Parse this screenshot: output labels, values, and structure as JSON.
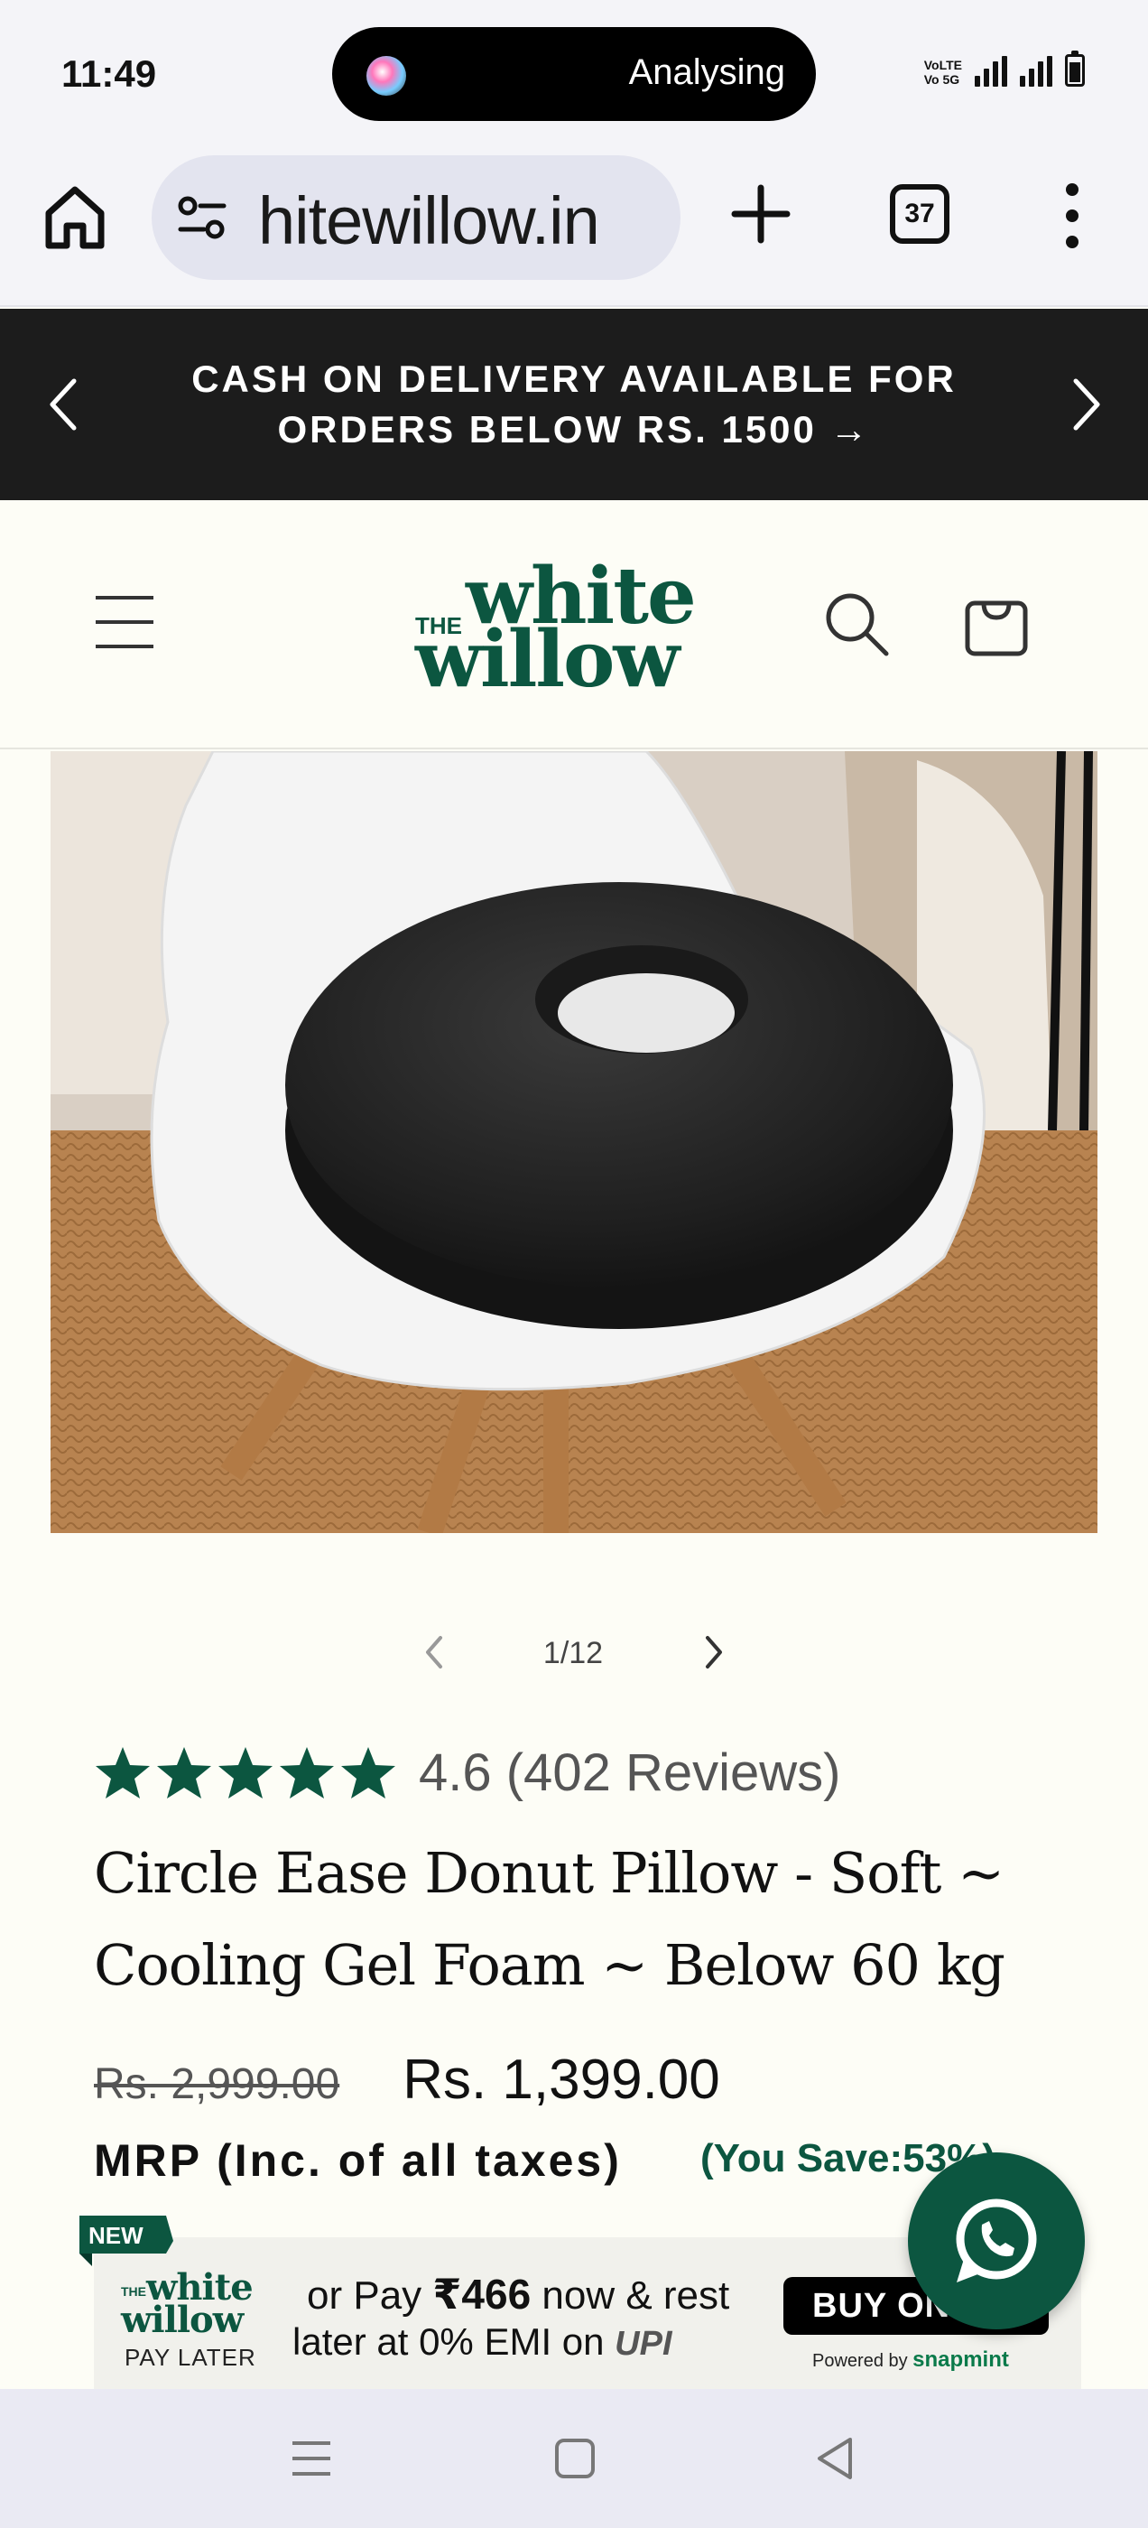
{
  "status": {
    "time": "11:49",
    "island_text": "Analysing",
    "network_label_1": "VoLTE",
    "network_label_2": "Vo 5G"
  },
  "browser": {
    "url": "hitewillow.in",
    "tab_count": "37"
  },
  "announcement": {
    "line1": "CASH ON DELIVERY AVAILABLE FOR",
    "line2": "ORDERS BELOW RS. 1500 →"
  },
  "logo": {
    "the": "THE",
    "word1": "white",
    "word2": "willow"
  },
  "slider": {
    "counter": "1/12"
  },
  "product": {
    "rating_value": 4.6,
    "rating_max": 5,
    "rating_text": "4.6 (402 Reviews)",
    "title_line1": "Circle Ease Donut Pillow - Soft ~",
    "title_line2": "Cooling Gel Foam ~ Below 60 kg",
    "old_price": "Rs. 2,999.00",
    "new_price": "Rs. 1,399.00",
    "mrp_label": "MRP (Inc. of all taxes)",
    "you_save": "(You Save:53%)"
  },
  "paylater": {
    "badge": "NEW",
    "logo_the": "THE",
    "logo_word1": "white",
    "logo_word2": "willow",
    "logo_sub": "PAY LATER",
    "line1_prefix": "or Pay ",
    "line1_amount": "₹466",
    "line1_suffix": " now & rest",
    "line2": "later at 0% EMI on ",
    "upi": "UPI",
    "buy_label": "BUY ON EMI",
    "powered_prefix": "Powered by ",
    "powered_brand": "snapmint"
  },
  "colors": {
    "brand_green": "#0c5640",
    "announce_bg": "#1c1c1c",
    "page_bg": "#fdfdf6"
  }
}
